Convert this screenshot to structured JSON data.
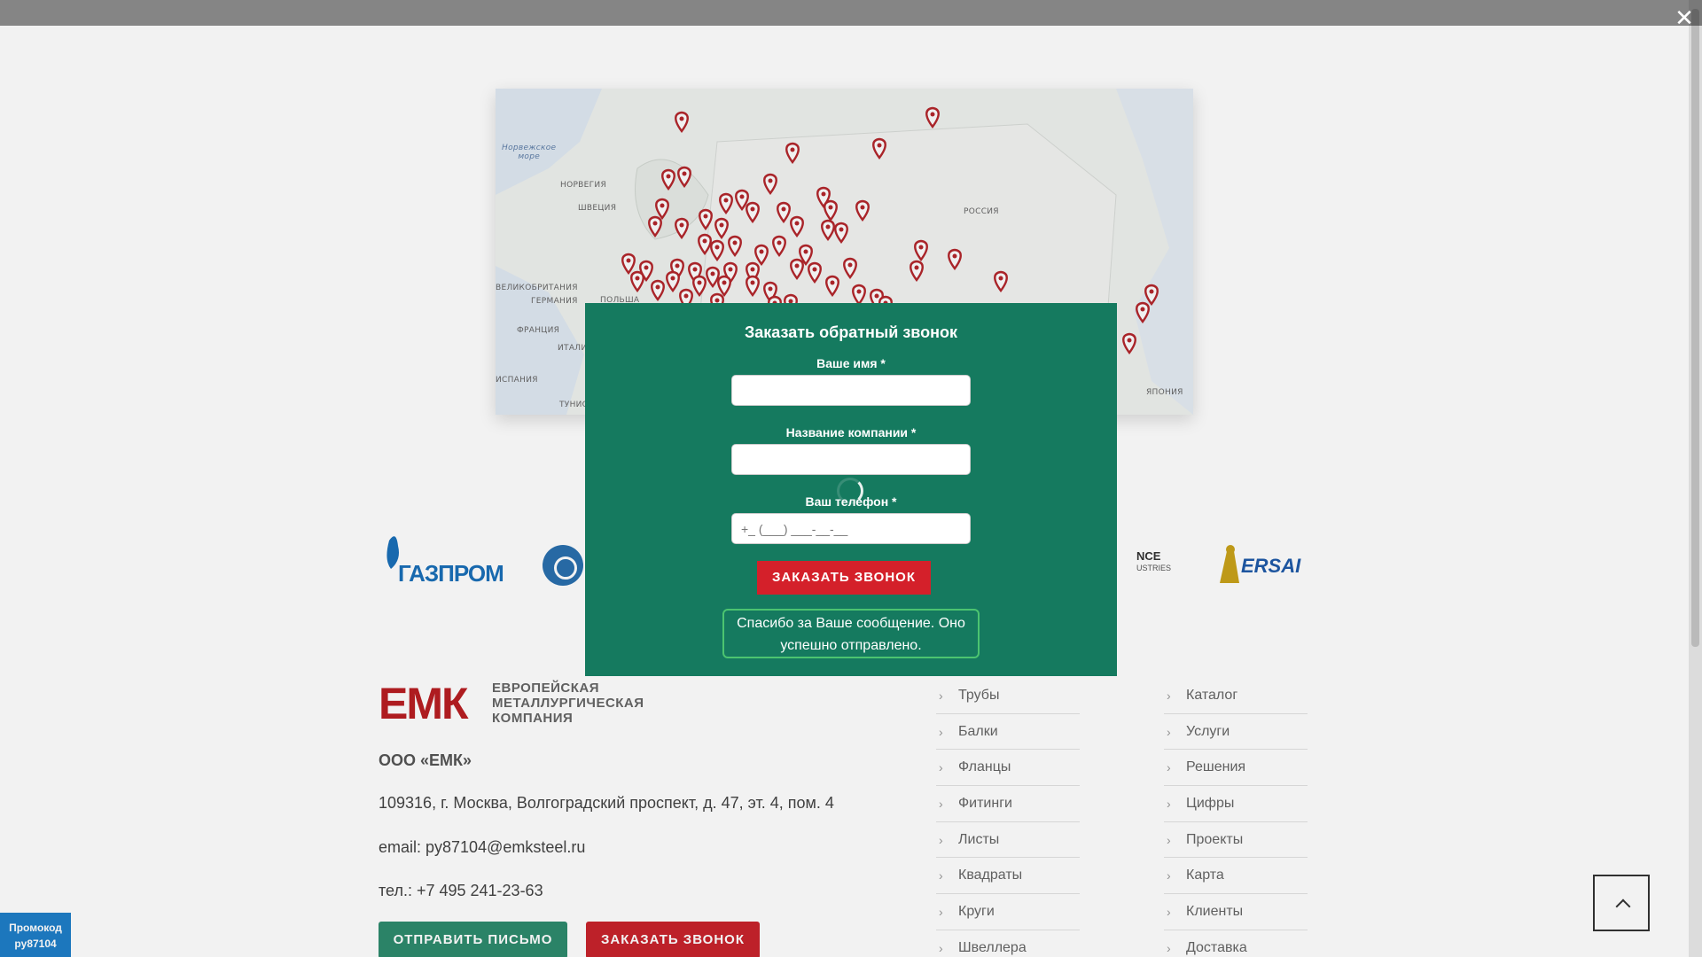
{
  "map": {
    "sea_label": "Норвежское\nморе",
    "labels": [
      "НОРВЕГИЯ",
      "ШВЕЦИЯ",
      "РОССИЯ",
      "ВЕЛИКОБРИТАНИЯ",
      "ГЕРМАНИЯ",
      "ПОЛЬША",
      "ФРАНЦИЯ",
      "ИТАЛИЯ",
      "ИСПАНИЯ",
      "ТУНИС",
      "ЯПОНИЯ"
    ]
  },
  "clients": {
    "gazprom": "ГАЗПРОМ",
    "alliance_big": "NCE",
    "alliance_small": "USTRIES",
    "ersai": "ERSAI"
  },
  "footer": {
    "logo_letters": "ЕМК",
    "logo_line1": "ЕВРОПЕЙСКАЯ",
    "logo_line2": "МЕТАЛЛУРГИЧЕСКАЯ",
    "logo_line3": "КОМПАНИЯ",
    "company": "ООО «ЕМК»",
    "address": "109316, г. Москва, Волгоградский проспект, д. 47, эт. 4, пом. 4",
    "email": "email: py87104@emksteel.ru",
    "phone": "тел.: +7 495 241-23-63",
    "btn_letter": "ОТПРАВИТЬ ПИСЬМО",
    "btn_call": "ЗАКАЗАТЬ ЗВОНОК",
    "menu1": [
      "Трубы",
      "Балки",
      "Фланцы",
      "Фитинги",
      "Листы",
      "Квадраты",
      "Круги",
      "Швеллера"
    ],
    "menu2": [
      "Каталог",
      "Услуги",
      "Решения",
      "Цифры",
      "Проекты",
      "Карта",
      "Клиенты",
      "Доставка"
    ]
  },
  "promo": {
    "line1": "Промокод",
    "line2": "py87104"
  },
  "modal": {
    "title": "Заказать обратный звонок",
    "name_label": "Ваше имя *",
    "company_label": "Название компании *",
    "phone_label": "Ваш телефон *",
    "phone_placeholder": "+_ (___) ___-__-__",
    "submit": "ЗАКАЗАТЬ ЗВОНОК",
    "success": "Спасибо за Ваше сообщение. Оно успешно отправлено."
  },
  "icons": {
    "close": "close-icon",
    "to_top": "chevron-up-icon",
    "map_pin": "map-pin-icon"
  },
  "colors": {
    "modal_bg": "#157a5f",
    "accent_red": "#d4202a",
    "success_border": "#4cc470",
    "brand_red": "#b81e22",
    "promo_blue": "#1e7ec8"
  }
}
